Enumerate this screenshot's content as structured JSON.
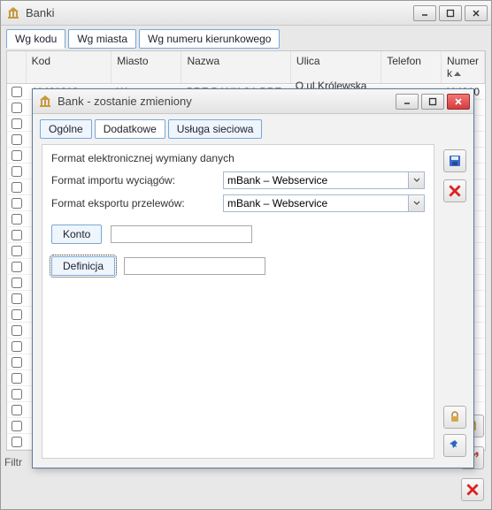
{
  "parent": {
    "title": "Banki",
    "tabs": [
      "Wg kodu",
      "Wg miasta",
      "Wg numeru kierunkowego"
    ],
    "active_tab": 0,
    "columns": [
      "Kod",
      "Miasto",
      "Nazwa",
      "Ulica",
      "Telefon",
      "Numer k"
    ],
    "rows": [
      {
        "kod": "11401010",
        "miasto": "Warszawa",
        "nazwa": "BRE BANK SA BRE",
        "ulica": "O.ul.Królewska 14",
        "telefon": "",
        "numer": "114010"
      }
    ],
    "filter_label": "Filtr"
  },
  "child": {
    "title": "Bank - zostanie zmieniony",
    "tabs": [
      "Ogólne",
      "Dodatkowe",
      "Usługa sieciowa"
    ],
    "active_tab": 1,
    "legend": "Format elektronicznej wymiany danych",
    "import_label": "Format importu wyciągów:",
    "export_label": "Format eksportu przelewów:",
    "import_value": "mBank – Webservice",
    "export_value": "mBank – Webservice",
    "konto_label": "Konto",
    "konto_value": "",
    "definicja_label": "Definicja",
    "definicja_value": ""
  },
  "icons": {
    "app": "bank-icon",
    "save": "save-icon",
    "delete": "delete-icon",
    "lock": "lock-icon",
    "pin": "pin-icon",
    "key": "key-icon",
    "close_red": "close-icon"
  }
}
